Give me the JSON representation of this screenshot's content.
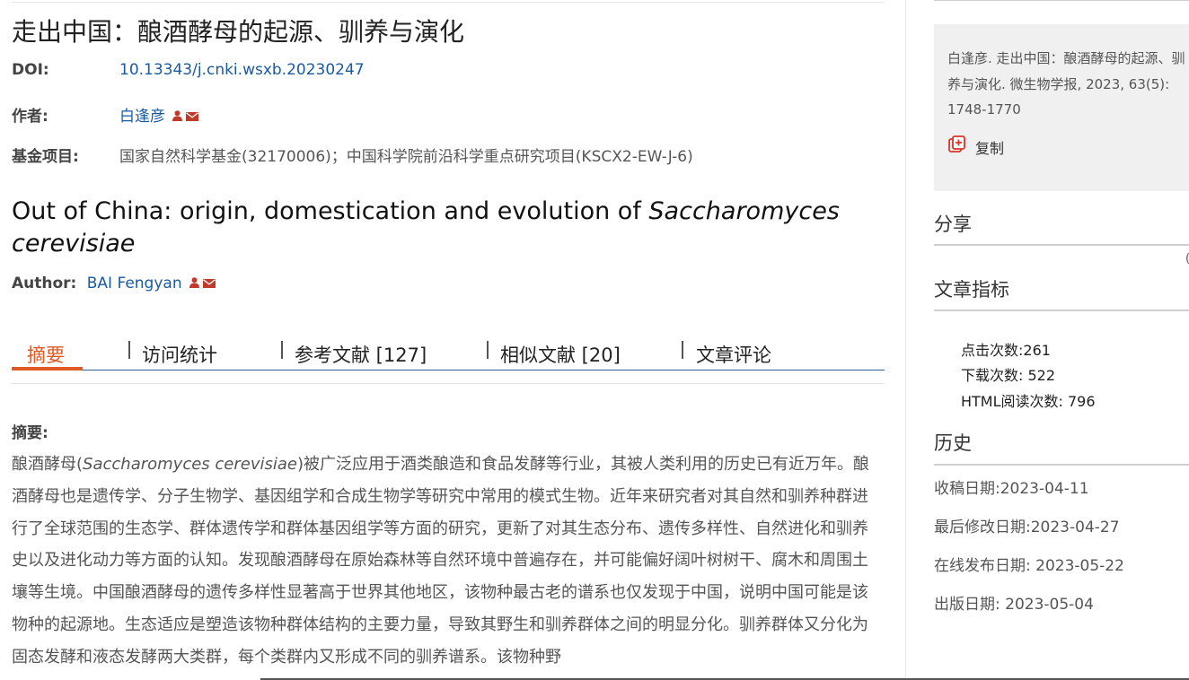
{
  "article": {
    "title_cn": "走出中国：酿酒酵母的起源、驯养与演化",
    "doi_label": "DOI:",
    "doi": "10.13343/j.cnki.wsxb.20230247",
    "author_label": "作者:",
    "author_cn": "白逢彦",
    "fund_label": "基金项目:",
    "fund": "国家自然科学基金(32170006)；中国科学院前沿科学重点研究项目(KSCX2-EW-J-6)",
    "title_en_pre": "Out of China: origin, domestication and evolution of ",
    "title_en_italic": "Saccharomyces cerevisiae",
    "author_en_label": "Author:",
    "author_en": "BAI Fengyan"
  },
  "tabs": [
    {
      "label": "摘要",
      "active": true
    },
    {
      "label": "访问统计"
    },
    {
      "label": "参考文献 [127]"
    },
    {
      "label": "相似文献 [20]"
    },
    {
      "label": "文章评论"
    }
  ],
  "abstract": {
    "heading": "摘要:",
    "part1": "酿酒酵母(",
    "species": "Saccharomyces cerevisiae",
    "part2": ")被广泛应用于酒类酿造和食品发酵等行业，其被人类利用的历史已有近万年。酿酒酵母也是遗传学、分子生物学、基因组学和合成生物学等研究中常用的模式生物。近年来研究者对其自然和驯养种群进行了全球范围的生态学、群体遗传学和群体基因组学等方面的研究，更新了对其生态分布、遗传多样性、自然进化和驯养史以及进化动力等方面的认知。发现酿酒酵母在原始森林等自然环境中普遍存在，并可能偏好阔叶树树干、腐木和周围土壤等生境。中国酿酒酵母的遗传多样性显著高于世界其他地区，该物种最古老的谱系也仅发现于中国，说明中国可能是该物种的起源地。生态适应是塑造该物种群体结构的主要力量，导致其野生和驯养群体之间的明显分化。驯养群体又分化为固态发酵和液态发酵两大类群，每个类群内又形成不同的驯养谱系。该物种野"
  },
  "sidebar": {
    "citation": "白逢彦. 走出中国：酿酒酵母的起源、驯养与演化. 微生物学报, 2023, 63(5): 1748-1770",
    "copy_label": "复制",
    "share_heading": "分享",
    "metrics_heading": "文章指标",
    "stats": [
      "点击次数:261",
      "下载次数: 522",
      "HTML阅读次数: 796"
    ],
    "history_heading": "历史",
    "history": [
      "收稿日期:2023-04-11",
      "最后修改日期:2023-04-27",
      "在线发布日期: 2023-05-22",
      "出版日期: 2023-05-04"
    ],
    "edge_char": "("
  },
  "colors": {
    "link": "#1a5aa0",
    "accent": "#e05a25",
    "tab_rule": "#2d5d9c",
    "sidebar_bg": "#f0f0f0",
    "copy_icon": "#d9342b"
  }
}
